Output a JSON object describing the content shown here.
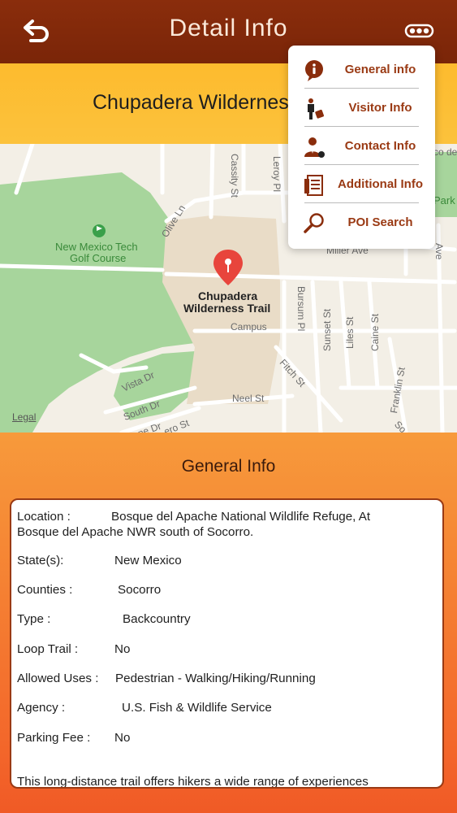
{
  "header": {
    "title": "Detail Info"
  },
  "trail_name_banner": "Chupadera Wilderness Trail",
  "map": {
    "pin_label_line1": "Chupadera",
    "pin_label_line2": "Wilderness Trail",
    "legal": "Legal",
    "labels": {
      "golf1": "New Mexico Tech",
      "golf2": "Golf Course",
      "olive": "Olive Ln",
      "cassity": "Cassity St",
      "leroy": "Leroy Pl",
      "miller": "Miller Ave",
      "campus": "Campus",
      "bursum": "Bursum Pl",
      "sunset": "Sunset St",
      "liles": "Liles St",
      "caine": "Caine St",
      "fitch": "Fitch St",
      "franklin": "Franklin St",
      "neel": "Neel St",
      "vista": "Vista Dr",
      "south": "South Dr",
      "ave": "Ave",
      "park": "Park",
      "code": "co de",
      "lane": "ne Dr",
      "so": "So",
      "ero": "ero St"
    }
  },
  "menu": {
    "items": [
      {
        "label": "General info",
        "icon": "info-icon"
      },
      {
        "label": "Visitor Info",
        "icon": "visitor-icon"
      },
      {
        "label": "Contact Info",
        "icon": "contact-icon"
      },
      {
        "label": "Additional Info",
        "icon": "document-icon"
      },
      {
        "label": "POI Search",
        "icon": "search-icon"
      }
    ]
  },
  "general": {
    "section_title": "General Info",
    "location_label": "Location :",
    "location_value": "Bosque del Apache National Wildlife Refuge, At",
    "location_value2": "Bosque del Apache NWR south of Socorro.",
    "state_label": "State(s):",
    "state_value": "New Mexico",
    "counties_label": "Counties :",
    "counties_value": "Socorro",
    "type_label": "Type :",
    "type_value": "Backcountry",
    "loop_label": "Loop Trail  :",
    "loop_value": "No",
    "uses_label": "Allowed Uses :",
    "uses_value": "Pedestrian - Walking/Hiking/Running",
    "agency_label": "Agency :",
    "agency_value": "U.S. Fish & Wildlife Service",
    "fee_label": "Parking Fee :",
    "fee_value": "No",
    "description": "This long-distance trail offers hikers a wide range of experiences"
  },
  "colors": {
    "navbar": "#7f280a",
    "title_band": "#fdbb2e",
    "accent_text": "#9a3a14",
    "pin": "#e8453c"
  }
}
